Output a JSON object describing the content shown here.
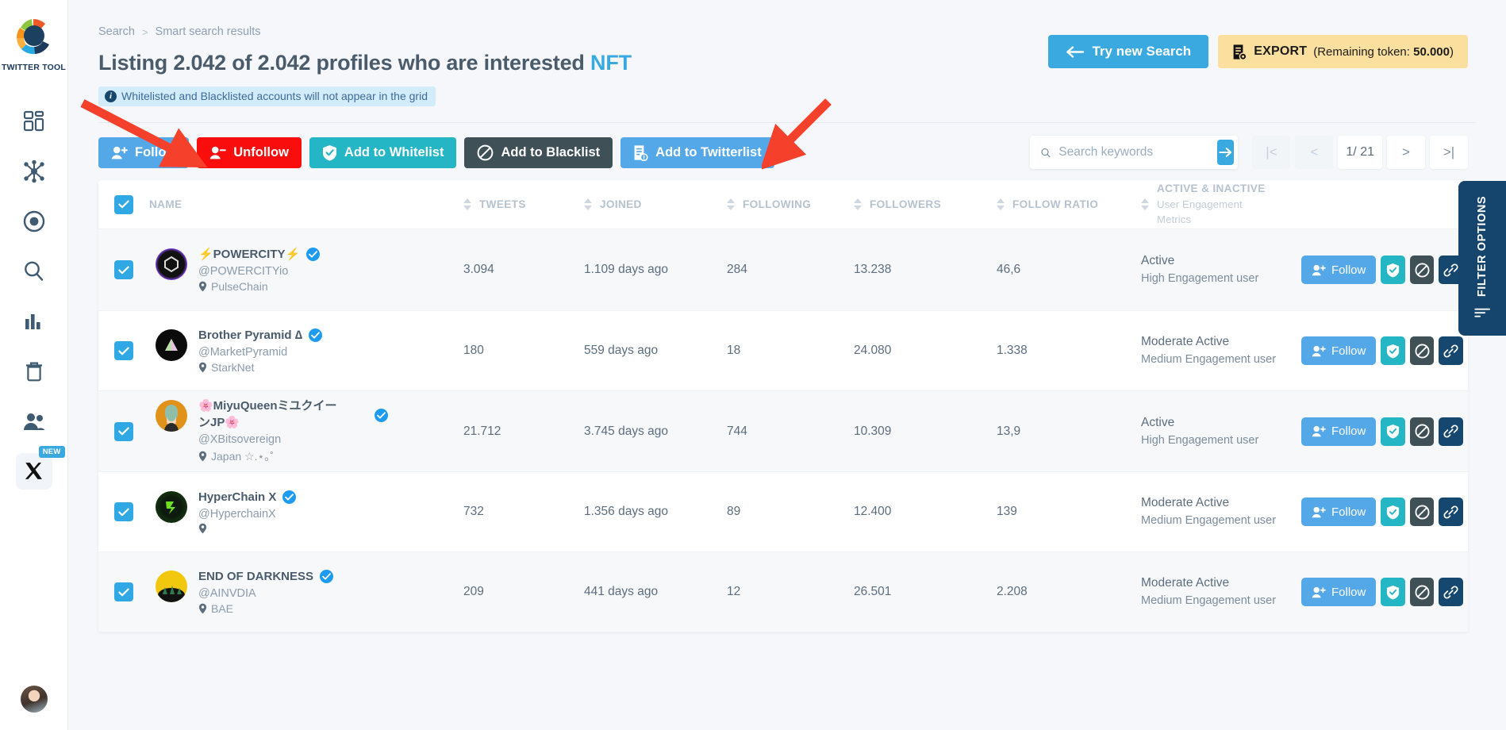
{
  "sidebar": {
    "logo_label": "TWITTER TOOL",
    "items": [
      {
        "name": "dashboard",
        "icon": "dashboard-icon"
      },
      {
        "name": "network",
        "icon": "network-icon"
      },
      {
        "name": "target",
        "icon": "target-icon"
      },
      {
        "name": "search",
        "icon": "search-icon"
      },
      {
        "name": "analytics",
        "icon": "bar-chart-icon"
      },
      {
        "name": "trash",
        "icon": "trash-icon"
      },
      {
        "name": "users",
        "icon": "users-icon"
      },
      {
        "name": "x-twitter",
        "icon": "x-icon",
        "badge": "NEW"
      }
    ]
  },
  "breadcrumb": {
    "root": "Search",
    "separator": ">",
    "current": "Smart search results"
  },
  "header": {
    "title_prefix": "Listing 2.042 of 2.042 profiles who are interested",
    "title_keyword": "NFT",
    "info_banner": "Whitelisted and Blacklisted accounts will not appear in the grid",
    "try_new_search": "Try new Search",
    "export_label": "EXPORT",
    "export_note_prefix": "(Remaining token:",
    "export_token": "50.000",
    "export_note_suffix": ")"
  },
  "actions": {
    "follow": "Follow",
    "unfollow": "Unfollow",
    "add_whitelist": "Add to Whitelist",
    "add_blacklist": "Add to Blacklist",
    "add_twitterlist": "Add to Twitterlist"
  },
  "search": {
    "placeholder": "Search keywords",
    "value": "",
    "go_icon": "arrow-right-icon"
  },
  "pagination": {
    "first": "|<",
    "prev": "<",
    "current": "1/ 21",
    "next": ">",
    "last": ">|"
  },
  "table": {
    "columns": {
      "name": "NAME",
      "tweets": "TWEETS",
      "joined": "JOINED",
      "following": "FOLLOWING",
      "followers": "FOLLOWERS",
      "follow_ratio": "FOLLOW RATIO",
      "active_title": "ACTIVE & INACTIVE",
      "active_sub1": "User Engagement",
      "active_sub2": "Metrics"
    },
    "row_action_follow": "Follow",
    "rows": [
      {
        "name": "⚡POWERCITY⚡",
        "handle": "@POWERCITYio",
        "location": "PulseChain",
        "verified": true,
        "tweets": "3.094",
        "joined": "1.109 days ago",
        "following": "284",
        "followers": "13.238",
        "follow_ratio": "46,6",
        "activity": "Active",
        "engagement": "High Engagement user"
      },
      {
        "name": "Brother Pyramid ∆",
        "handle": "@MarketPyramid",
        "location": "StarkNet",
        "verified": true,
        "tweets": "180",
        "joined": "559 days ago",
        "following": "18",
        "followers": "24.080",
        "follow_ratio": "1.338",
        "activity": "Moderate Active",
        "engagement": "Medium Engagement user"
      },
      {
        "name": "🌸MiyuQueenミユクイーンJP🌸",
        "handle": "@XBitsovereign",
        "location": "Japan ☆.⋆｡˚",
        "verified": true,
        "tweets": "21.712",
        "joined": "3.745 days ago",
        "following": "744",
        "followers": "10.309",
        "follow_ratio": "13,9",
        "activity": "Active",
        "engagement": "High Engagement user"
      },
      {
        "name": "HyperChain X",
        "handle": "@HyperchainX",
        "location": "",
        "verified": true,
        "tweets": "732",
        "joined": "1.356 days ago",
        "following": "89",
        "followers": "12.400",
        "follow_ratio": "139",
        "activity": "Moderate Active",
        "engagement": "Medium Engagement user"
      },
      {
        "name": "END OF DARKNESS",
        "handle": "@AINVDIA",
        "location": "BAE",
        "verified": true,
        "tweets": "209",
        "joined": "441 days ago",
        "following": "12",
        "followers": "26.501",
        "follow_ratio": "2.208",
        "activity": "Moderate Active",
        "engagement": "Medium Engagement user"
      }
    ]
  },
  "filter_panel": {
    "label": "FILTER OPTIONS"
  },
  "colors": {
    "accent_blue": "#3aa9e0",
    "follow_blue": "#54a8e8",
    "danger_red": "#f90d0d",
    "teal": "#24b6c4",
    "slate": "#3f5057",
    "navy": "#15456c",
    "export_yellow": "#fbdf9e",
    "annotation_red": "#f5402c"
  }
}
